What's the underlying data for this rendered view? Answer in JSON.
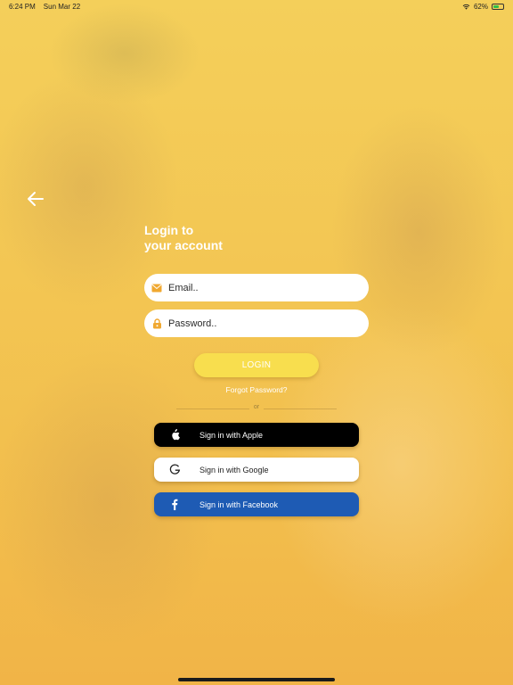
{
  "status_bar": {
    "time": "6:24 PM",
    "date": "Sun Mar 22",
    "battery_text": "62%",
    "battery_level": 0.62,
    "icons": [
      "wifi-icon",
      "battery-icon"
    ]
  },
  "nav": {
    "back_icon": "back-arrow-icon"
  },
  "heading": {
    "line1": "Login to",
    "line2": "your account"
  },
  "form": {
    "email_placeholder": "Email..",
    "email_icon": "envelope-icon",
    "password_placeholder": "Password..",
    "password_icon": "lock-icon",
    "login_label": "LOGIN",
    "forgot_label": "Forgot Password?"
  },
  "divider": {
    "label": "or"
  },
  "social": {
    "apple_label": "Sign in with Apple",
    "google_label": "Sign in with Google",
    "facebook_label": "Sign in with Facebook"
  },
  "colors": {
    "accent": "#f8de4e",
    "background": "#f2c14e",
    "facebook": "#1e5bb4",
    "apple": "#000000",
    "icon_orange": "#f0a830"
  }
}
